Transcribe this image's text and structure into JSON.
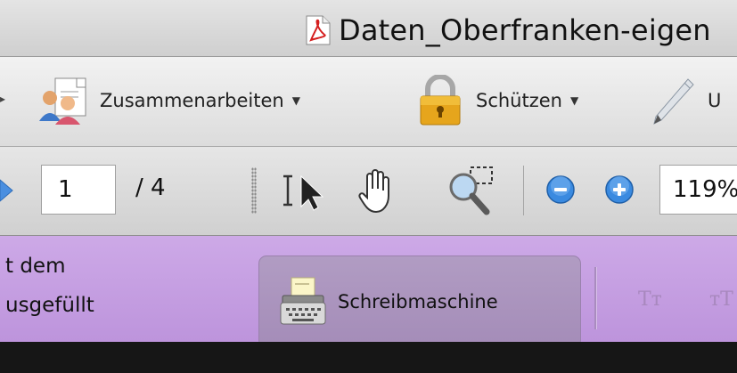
{
  "window": {
    "title": "Daten_Oberfranken-eigen"
  },
  "toolbar": {
    "collaborate_label": "Zusammenarbeiten",
    "protect_label": "Schützen",
    "sign_label_partial": "U"
  },
  "navigation": {
    "current_page": "1",
    "total_pages": "/ 4",
    "zoom": "119%"
  },
  "typewriter_bar": {
    "info_line1": "t dem",
    "info_line2": "usgefüllt",
    "typewriter_label": "Schreibmaschine",
    "text_size_glyph_1": "Tт",
    "text_size_glyph_2": "тT"
  },
  "colors": {
    "typewriter_bar_bg": "#c69fe3",
    "typewriter_button_bg": "#a890bb"
  }
}
